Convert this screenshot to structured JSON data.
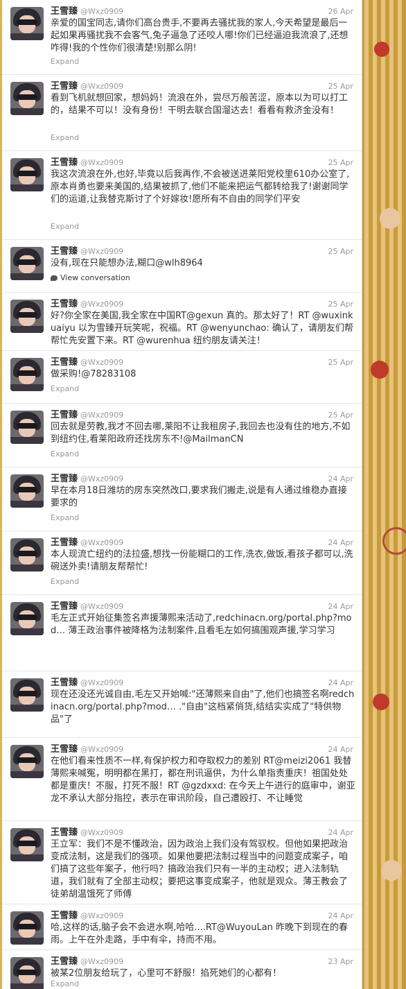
{
  "tweets": [
    {
      "name": "王雪臻",
      "handle": "@Wxz0909",
      "time": "26 Apr",
      "text": "亲爱的国宝同志,请你们高台贵手,不要再去骚扰我的家人,今天希望是最后一起如果再骚扰我不会客气,兔子逼急了还咬人哪!你们已经逼迫我流浪了,还想咋得!我的个性你们很清楚!别那么阴!",
      "action": "Expand"
    },
    {
      "name": "王雪臻",
      "handle": "@Wxz0909",
      "time": "25 Apr",
      "text": "看到飞机就想回家，想妈妈！流浪在外，尝尽万般苦涩，原本以为可以打工的，结果不可以！没有身份！干明去联合国溜达去！看看有救济金没有！",
      "action": "Expand"
    },
    {
      "name": "王雪臻",
      "handle": "@Wxz0909",
      "time": "25 Apr",
      "text": "我这次流浪在外,也好,毕竟以后我再作,不会被送进莱阳党校里610办公室了,原本肖勇也要来美国的,结果被抓了,他们不能来把运气都转给我了!谢谢同学们的运道,让我替克斯讨了个好嫁妆!愿所有不自由的同学们平安",
      "action": "Expand"
    },
    {
      "name": "王雪臻",
      "handle": "@Wxz0909",
      "time": "25 Apr",
      "text": "没有,现在只能想办法,糊口@wlh8964",
      "action": "View conversation"
    },
    {
      "name": "王雪臻",
      "handle": "@Wxz0909",
      "time": "25 Apr",
      "text": "好?你全家在美国,我全家在中国RT@gexun 真的。那太好了！RT @wuxinkuaiyu 以为雪臻开玩笑呢，祝福。RT @wenyunchao: 确认了，请朋友们帮帮忙先安置下来。RT @wurenhua 纽约朋友请关注！",
      "action": ""
    },
    {
      "name": "王雪臻",
      "handle": "@Wxz0909",
      "time": "25 Apr",
      "text": "做采购!@78283108",
      "action": "Expand"
    },
    {
      "name": "王雪臻",
      "handle": "@Wxz0909",
      "time": "25 Apr",
      "text": "回去就是劳教,我才不回去哪,莱阳不让我租房子,我回去也没有住的地方,不如到纽约住,看莱阳政府还找房东不!@MailmanCN",
      "action": "Expand"
    },
    {
      "name": "王雪臻",
      "handle": "@Wxz0909",
      "time": "24 Apr",
      "text": "早在本月18日潍坊的房东突然改口,要求我们搬走,说是有人通过维稳办直接要求的",
      "action": "Expand"
    },
    {
      "name": "王雪臻",
      "handle": "@Wxz0909",
      "time": "24 Apr",
      "text": "本人现流亡纽约的法拉盛,想找一份能糊口的工作,洗衣,做饭,看孩子都可以,洗碗送外卖!请朋友帮帮忙!",
      "action": "Expand"
    },
    {
      "name": "王雪臻",
      "handle": "@Wxz0909",
      "time": "24 Apr",
      "text": "毛左正式开始征集签名声援薄熙来活动了,redchinacn.org/portal.php?mod… 薄王政治事件被降格为法制案件,且看毛左如何搞围观声援,学习学习",
      "action": ""
    },
    {
      "name": "王雪臻",
      "handle": "@Wxz0909",
      "time": "24 Apr",
      "text": "现在还没还光诚自由,毛左又开始喊:\"还薄熙来自由\"了,他们也搞签名啊redchinacn.org/portal.php?mod… .\"自由\"这档紧俏货,结结实实成了\"特供物品\"了",
      "action": ""
    },
    {
      "name": "王雪臻",
      "handle": "@Wxz0909",
      "time": "24 Apr",
      "text": "在他们看来性质不一样,有保护权力和夺取权力的差别 RT@meizi2061 我替薄熙来喊冤，明明都在黑打，都在刑讯逼供，为什么单指责重庆！祖国处处都是重庆！不服，打死不服！RT @gzdxxd: 在今天上午进行的庭审中，谢亚龙不承认大部分指控，表示在审讯阶段，自己遭殴打、不让睡觉",
      "action": ""
    },
    {
      "name": "王雪臻",
      "handle": "@Wxz0909",
      "time": "24 Apr",
      "text": "王立军：我们不是不懂政治，因为政治上我们没有驾驭权。但他如果把政治变成法制，这是我们的强项。如果他要把法制过程当中的问题变成案子，咱们搞了这些年案子，他行吗？搞政治我们只有一半的主动权；进入法制轨道，我们就有了全部主动权；要把这事变成案子，他就是观众。薄王教会了徒弟胡温饿死了师傅",
      "action": ""
    },
    {
      "name": "王雪臻",
      "handle": "@Wxz0909",
      "time": "24 Apr",
      "text": "哈,这样的话,脑子会不会进水啊,哈哈....RT@WuyouLan 昨晚下到现在的春雨。上午在外走路，手中有伞，持而不用。",
      "action": ""
    },
    {
      "name": "王雪臻",
      "handle": "@Wxz0909",
      "time": "23 Apr",
      "text": "被某2位朋友给玩了，心里可不舒服！掐死她们的心都有！",
      "action": "Expand"
    }
  ]
}
